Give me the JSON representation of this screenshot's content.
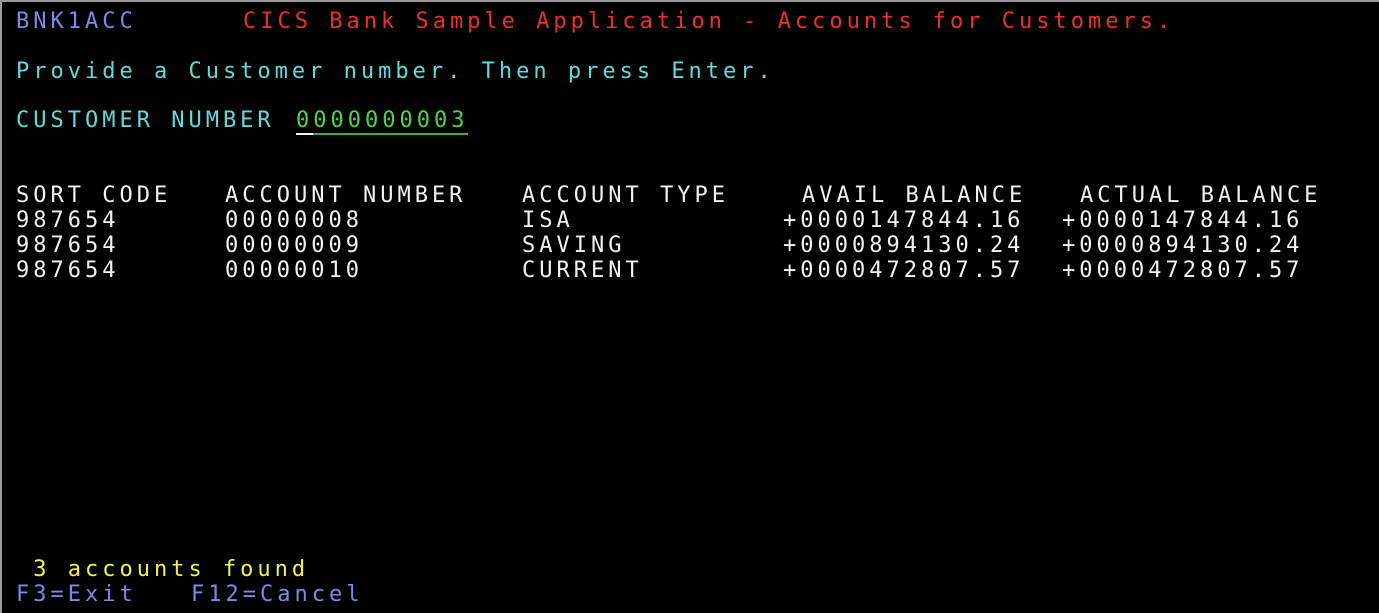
{
  "header": {
    "transaction_id": "BNK1ACC",
    "title": "CICS Bank Sample Application - Accounts for Customers."
  },
  "instruction": "Provide a Customer number. Then press Enter.",
  "customer": {
    "label": "CUSTOMER NUMBER",
    "value": "0000000003"
  },
  "table": {
    "columns": [
      "SORT CODE",
      "ACCOUNT NUMBER",
      "ACCOUNT TYPE",
      "AVAIL BALANCE",
      "ACTUAL BALANCE"
    ],
    "rows": [
      [
        "987654",
        "00000008",
        "ISA",
        "+0000147844.16",
        "+0000147844.16"
      ],
      [
        "987654",
        "00000009",
        "SAVING",
        "+0000894130.24",
        "+0000894130.24"
      ],
      [
        "987654",
        "00000010",
        "CURRENT",
        "+0000472807.57",
        "+0000472807.57"
      ]
    ]
  },
  "status_message": " 3 accounts found",
  "function_keys": [
    {
      "label": "F3=Exit"
    },
    {
      "label": "F12=Cancel"
    }
  ],
  "colors": {
    "protected_blue": "#7f88e6",
    "title_red": "#e8302c",
    "label_turquoise": "#62dada",
    "input_green": "#4fd34f",
    "data_white": "#f2f2f2",
    "message_yellow": "#f2f24a"
  }
}
